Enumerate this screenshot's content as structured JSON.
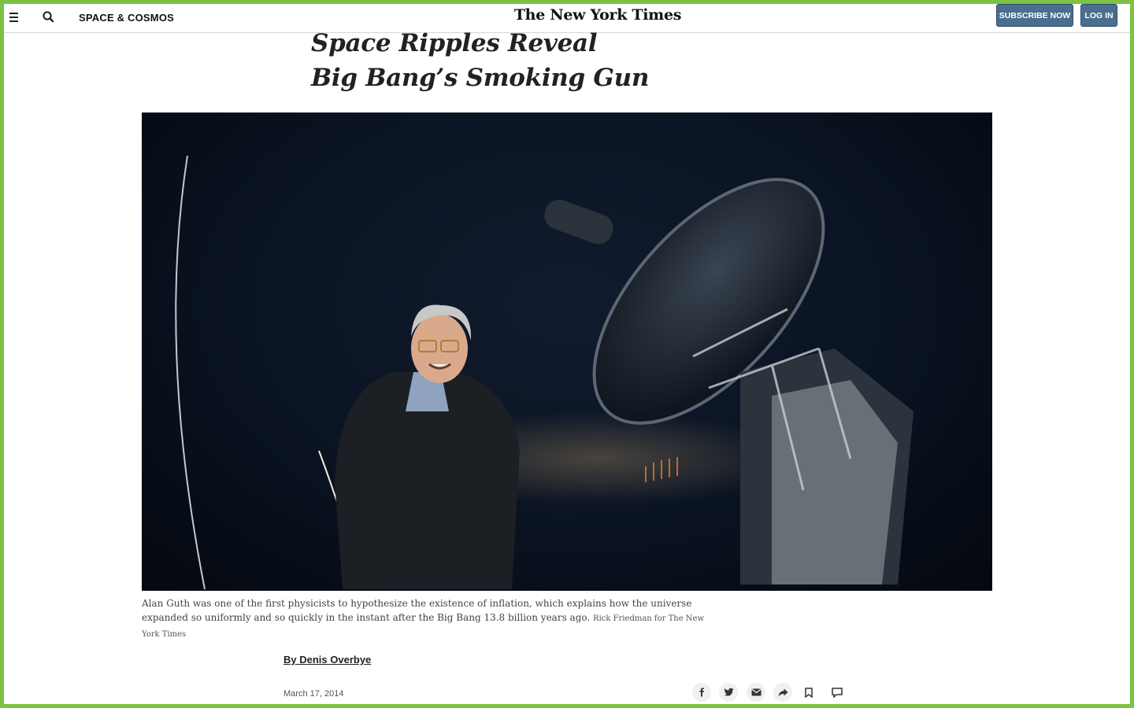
{
  "header": {
    "section": "SPACE & COSMOS",
    "logo": "The New York Times",
    "subscribe_label": "SUBSCRIBE NOW",
    "login_label": "LOG IN"
  },
  "article": {
    "headline_line1": "Space Ripples Reveal",
    "headline_line2": "Big Bang’s Smoking Gun",
    "caption": "Alan Guth was one of the first physicists to hypothesize the existence of inflation, which explains how the universe expanded so uniformly and so quickly in the instant after the Big Bang 13.8 billion years ago.",
    "credit": "Rick Friedman for The New York Times",
    "byline": "By Denis Overbye",
    "date": "March 17, 2014"
  },
  "share_tools": [
    "facebook-icon",
    "twitter-icon",
    "email-icon",
    "share-icon",
    "bookmark-icon",
    "comment-icon"
  ],
  "colors": {
    "frame": "#7cc243",
    "button": "#4a6e8e"
  }
}
